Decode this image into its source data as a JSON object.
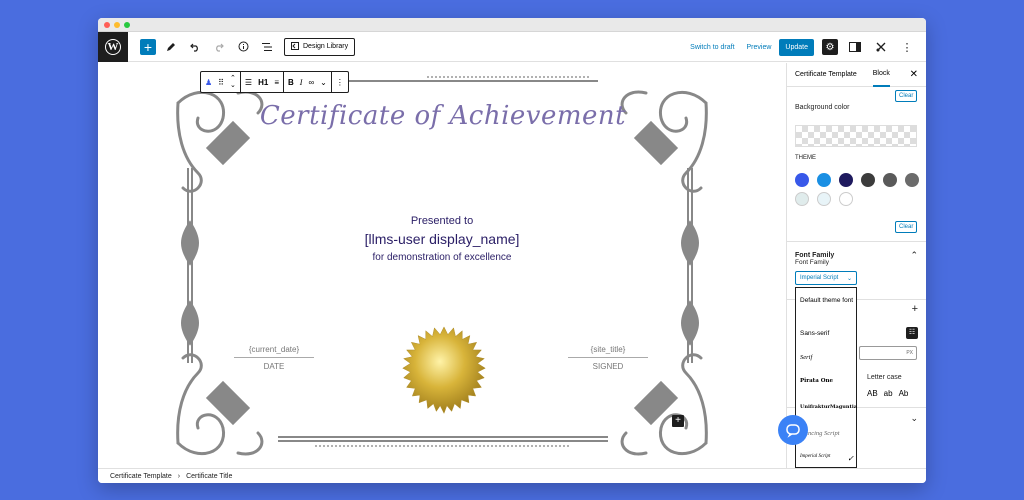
{
  "toolbar": {
    "design_library": "Design Library",
    "switch_to_draft": "Switch to draft",
    "preview": "Preview",
    "update": "Update"
  },
  "block_toolbar": {
    "heading_level": "H1",
    "bold": "B",
    "italic": "I"
  },
  "certificate": {
    "title": "Certificate of Achievement",
    "presented_to": "Presented to",
    "user_name": "[llms-user display_name]",
    "subtitle": "for demonstration of excellence",
    "date_value": "{current_date}",
    "date_label": "DATE",
    "site_value": "{site_title}",
    "site_label": "SIGNED"
  },
  "sidebar": {
    "tab_template": "Certificate Template",
    "tab_block": "Block",
    "clear_top": "Clear",
    "background_color_label": "Background color",
    "theme_label": "THEME",
    "clear_bottom": "Clear",
    "font_family_section": "Font Family",
    "font_family_label": "Font Family",
    "font_family_value": "Imperial Script",
    "letter_case_label": "Letter case",
    "letter_case_options": [
      "AB",
      "ab",
      "Ab"
    ],
    "px_unit": "PX",
    "theme_colors": [
      "#3858e9",
      "#1a8fe3",
      "#1e1a5e",
      "#3c3c3c",
      "#5a5a5a",
      "#6b6b6b",
      "#e0ecec",
      "#e8f4f8",
      "#ffffff"
    ],
    "font_options": [
      {
        "label": "Default theme font"
      },
      {
        "label": "Sans-serif"
      },
      {
        "label": "Serif"
      },
      {
        "label": "Pirata One"
      },
      {
        "label": "UnifrakturMaguntia"
      },
      {
        "label": "Dancing Script"
      },
      {
        "label": "Imperial Script",
        "selected": true
      }
    ]
  },
  "breadcrumb": {
    "items": [
      "Certificate Template",
      "Certificate Title"
    ]
  },
  "colors": {
    "accent": "#007cba",
    "title_purple": "#7a6eaa",
    "text_navy": "#2a1e66",
    "page_bg": "#4a6ddf"
  }
}
